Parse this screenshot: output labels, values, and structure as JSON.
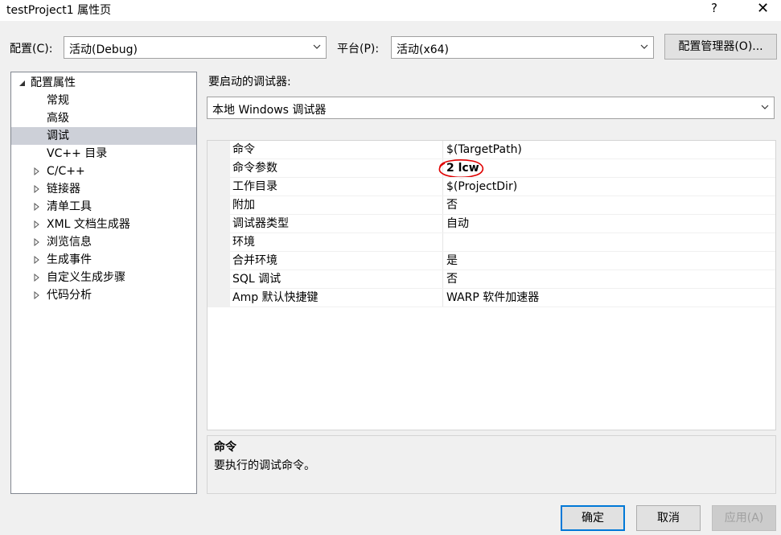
{
  "window": {
    "title": "testProject1 属性页",
    "help": "?",
    "close": "✕"
  },
  "top": {
    "config_label": "配置(C):",
    "config_value": "活动(Debug)",
    "platform_label": "平台(P):",
    "platform_value": "活动(x64)",
    "manager_button": "配置管理器(O)..."
  },
  "tree": {
    "root": "配置属性",
    "items": [
      "常规",
      "高级",
      "调试",
      "VC++ 目录",
      "C/C++",
      "链接器",
      "清单工具",
      "XML 文档生成器",
      "浏览信息",
      "生成事件",
      "自定义生成步骤",
      "代码分析"
    ],
    "selected": "调试"
  },
  "debugger": {
    "label": "要启动的调试器:",
    "value": "本地 Windows 调试器"
  },
  "grid": {
    "rows": [
      {
        "name": "命令",
        "value": "$(TargetPath)"
      },
      {
        "name": "命令参数",
        "value": "2 lcw"
      },
      {
        "name": "工作目录",
        "value": "$(ProjectDir)"
      },
      {
        "name": "附加",
        "value": "否"
      },
      {
        "name": "调试器类型",
        "value": "自动"
      },
      {
        "name": "环境",
        "value": ""
      },
      {
        "name": "合并环境",
        "value": "是"
      },
      {
        "name": "SQL 调试",
        "value": "否"
      },
      {
        "name": "Amp 默认快捷键",
        "value": "WARP 软件加速器"
      }
    ]
  },
  "description": {
    "title": "命令",
    "text": "要执行的调试命令。"
  },
  "buttons": {
    "ok": "确定",
    "cancel": "取消",
    "apply": "应用(A)"
  },
  "colors": {
    "selection": "#cdd0d8",
    "accent": "#0078d7",
    "annotation": "#e00000"
  }
}
